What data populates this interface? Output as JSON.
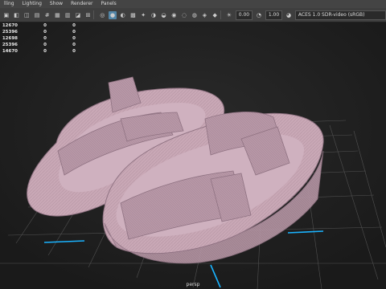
{
  "menu": [
    "lling",
    "Lighting",
    "Show",
    "Renderer",
    "Panels"
  ],
  "toolbar": {
    "exposure": "0.00",
    "gamma": "1.00",
    "color_space": "ACES 1.0 SDR-video (sRGB)"
  },
  "hud_rows": [
    [
      "12670",
      "0",
      "0"
    ],
    [
      "25396",
      "0",
      "0"
    ],
    [
      "12698",
      "0",
      "0"
    ],
    [
      "25396",
      "0",
      "0"
    ],
    [
      "14670",
      "0",
      "0"
    ]
  ],
  "viewport": {
    "camera_label": "persp",
    "background_color": "#1f1f1f",
    "grid_color": "#5a5a5a",
    "axis_color": "#1ab3ff",
    "model_color": "#c9a8b6"
  }
}
